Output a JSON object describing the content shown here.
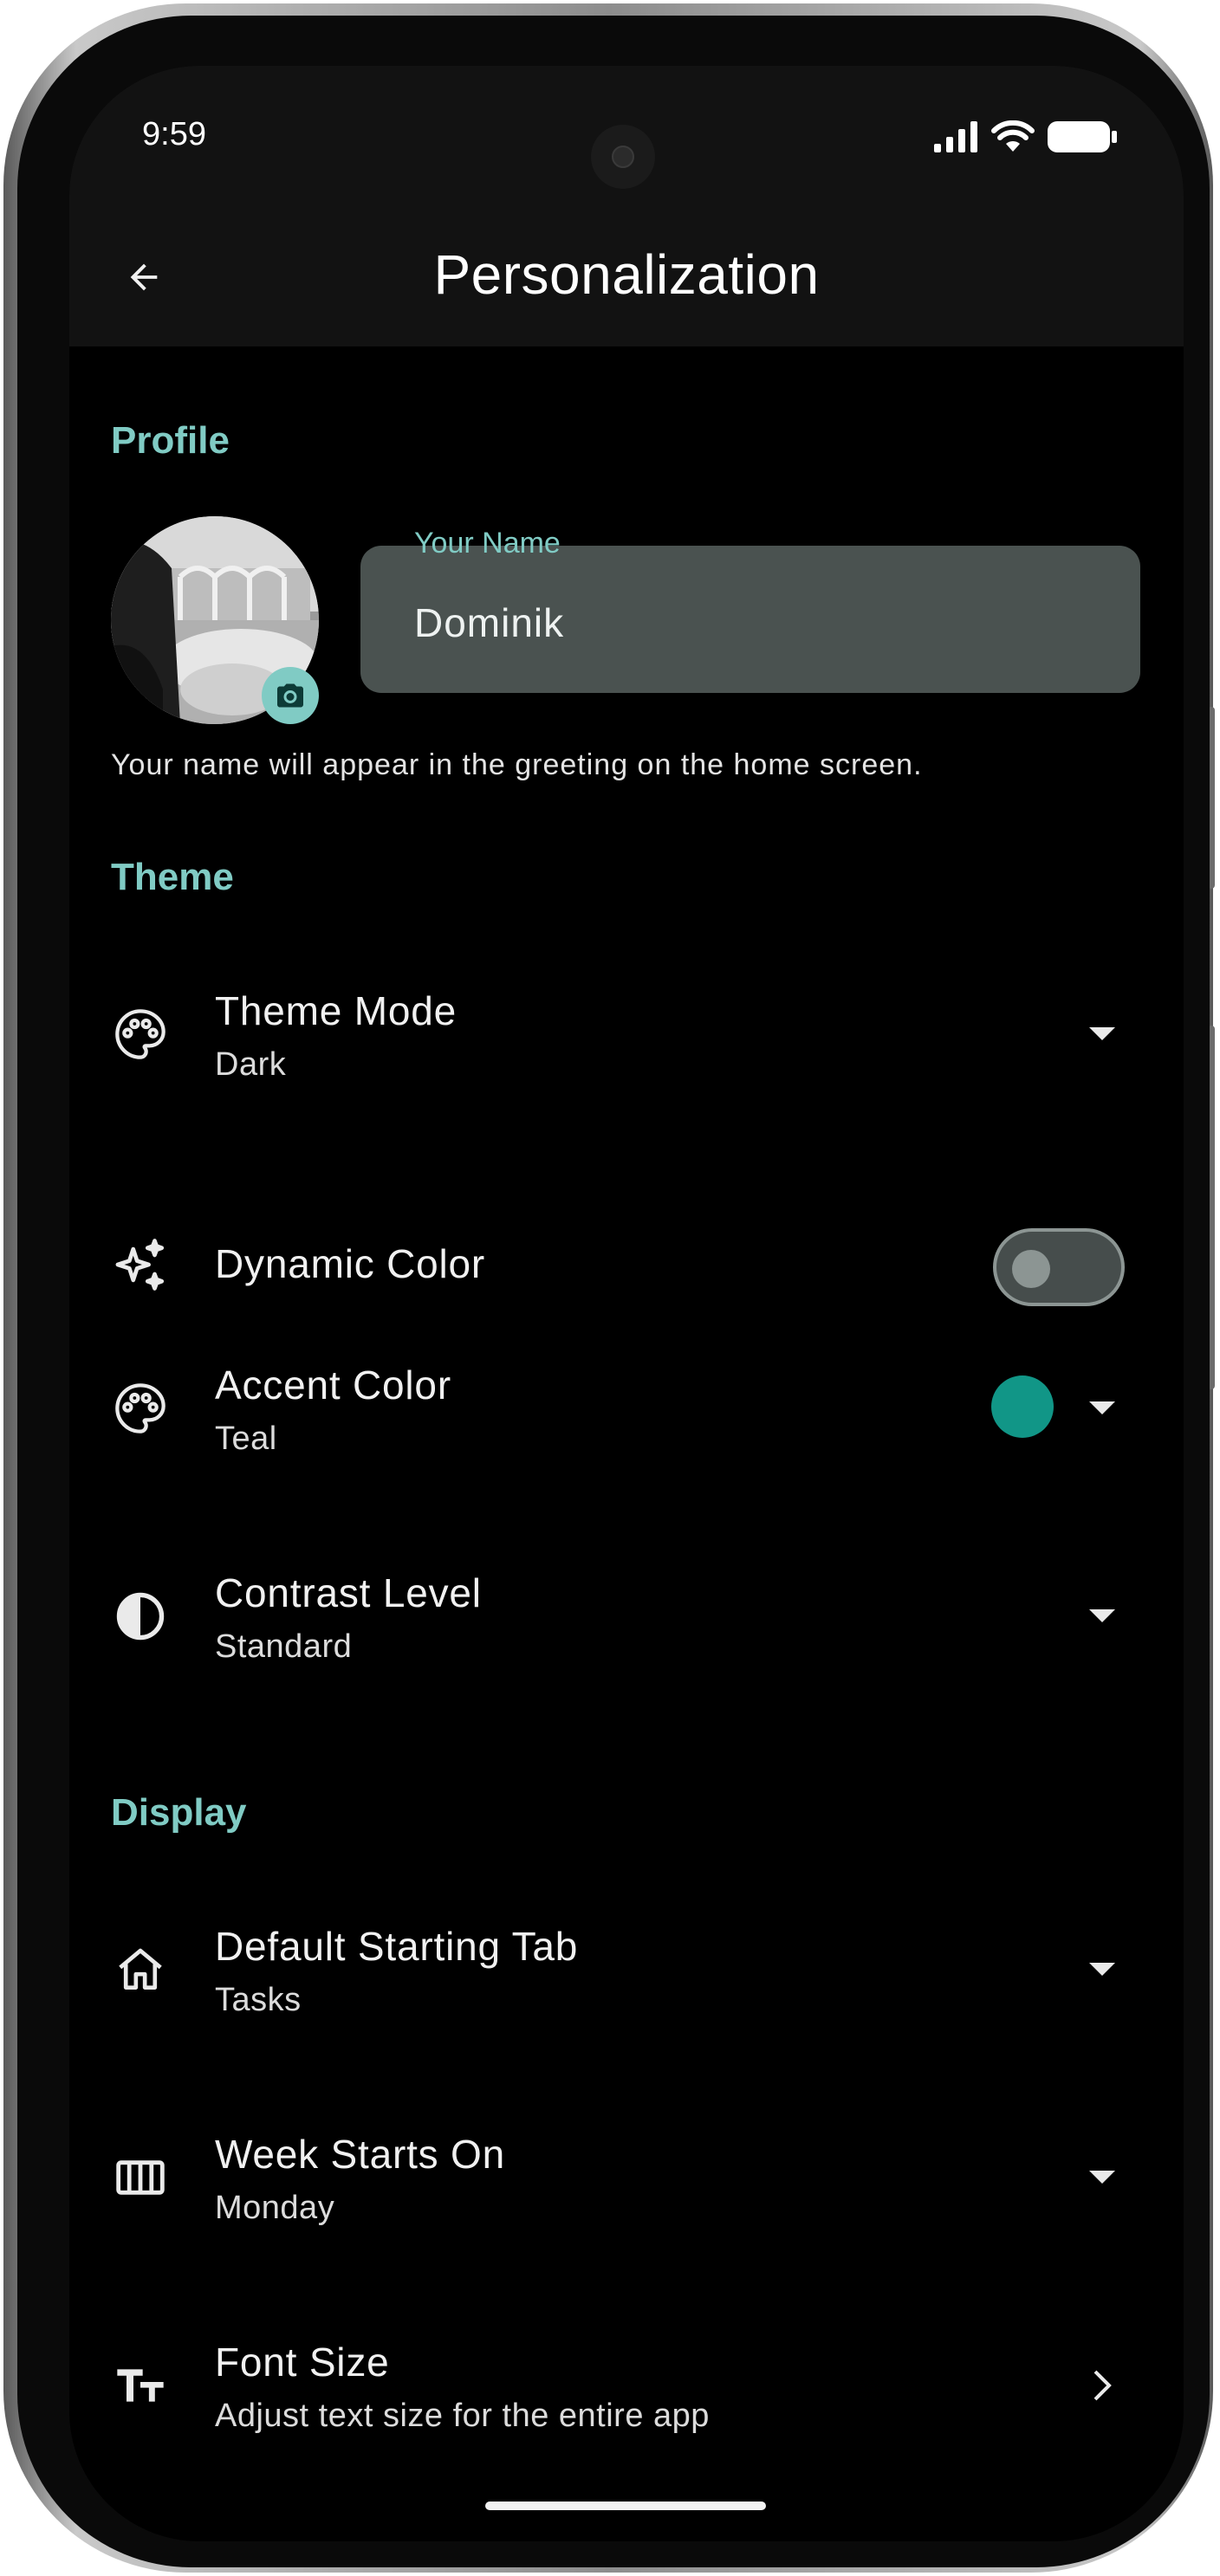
{
  "status_bar": {
    "time": "9:59"
  },
  "app_bar": {
    "title": "Personalization"
  },
  "profile": {
    "section_title": "Profile",
    "name_label": "Your Name",
    "name_value": "Dominik",
    "helper": "Your name will appear in the greeting on the home screen."
  },
  "theme": {
    "section_title": "Theme",
    "theme_mode": {
      "label": "Theme Mode",
      "value": "Dark",
      "icon": "palette-icon"
    },
    "dynamic_color": {
      "label": "Dynamic Color",
      "enabled": false,
      "icon": "sparkle-icon"
    },
    "accent_color": {
      "label": "Accent Color",
      "value": "Teal",
      "swatch": "#119687",
      "icon": "palette-icon"
    },
    "contrast_level": {
      "label": "Contrast Level",
      "value": "Standard",
      "icon": "contrast-icon"
    }
  },
  "display": {
    "section_title": "Display",
    "default_tab": {
      "label": "Default Starting Tab",
      "value": "Tasks",
      "icon": "home-icon"
    },
    "week_start": {
      "label": "Week Starts On",
      "value": "Monday",
      "icon": "calendar-week-icon"
    },
    "font_size": {
      "label": "Font Size",
      "value": "Adjust text size for the entire app",
      "icon": "text-size-icon"
    }
  },
  "colors": {
    "accent": "#80cbc4",
    "background": "#000000",
    "app_bar": "#121212"
  }
}
